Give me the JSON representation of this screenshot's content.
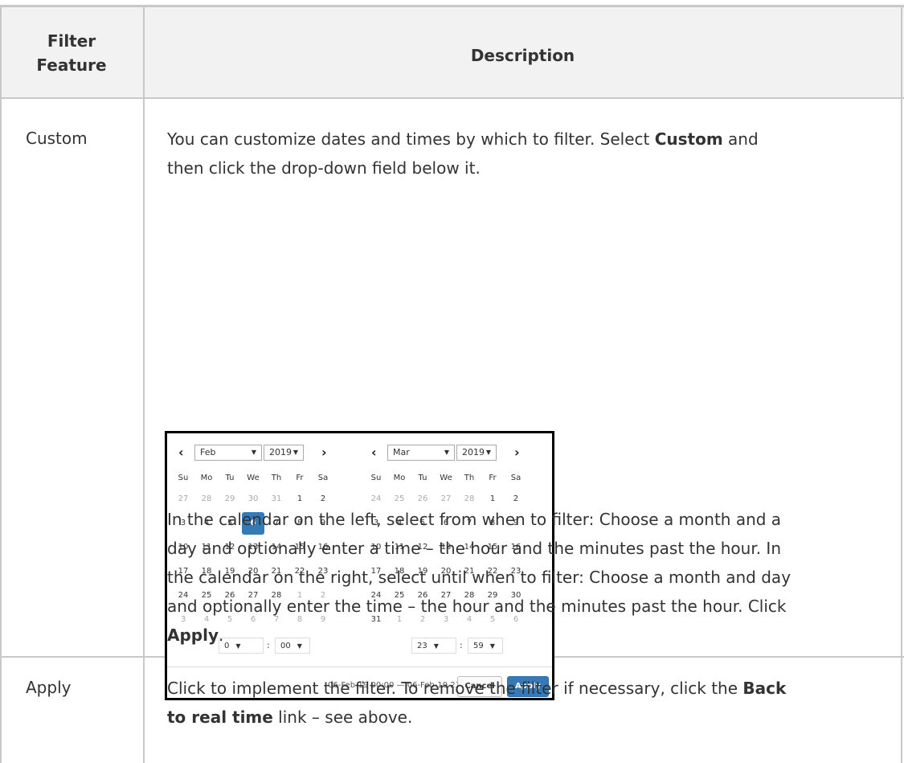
{
  "table": {
    "headers": [
      "Filter\nFeature",
      "Description"
    ],
    "header_col1_lines": [
      "Filter",
      "Feature"
    ],
    "header_col2": "Description"
  },
  "rows": [
    {
      "feature": "Custom",
      "intro_lines": [
        [
          "You can customize dates and times by which to filter. Select ",
          {
            "b": "Custom"
          },
          " and"
        ],
        [
          "then click the drop-down field below it."
        ]
      ],
      "after_lines": [
        [
          "In the calendar on the left, select from when to filter: Choose a month and a"
        ],
        [
          "day and optionally enter a time – the hour and the minutes past the hour. In"
        ],
        [
          "the calendar on the right, select until when to filter: Choose a month and day"
        ],
        [
          "and optionally enter the time – the hour and the minutes past the hour. Click"
        ],
        [
          {
            "b": "Apply"
          },
          "."
        ]
      ]
    },
    {
      "feature": "Apply",
      "lines": [
        [
          "Click to implement the filter. To remove the filter if necessary, click the ",
          {
            "b": "Back"
          }
        ],
        [
          {
            "b": "to real time"
          },
          " link – see above."
        ]
      ]
    }
  ],
  "calendar": {
    "weekdays": [
      "Su",
      "Mo",
      "Tu",
      "We",
      "Th",
      "Fr",
      "Sa"
    ],
    "left": {
      "month": "Feb",
      "year": "2019",
      "weeks": [
        [
          "27",
          "28",
          "29",
          "30",
          "31",
          "1",
          "2"
        ],
        [
          "3",
          "4",
          "5",
          "6",
          "7",
          "8",
          "9"
        ],
        [
          "10",
          "11",
          "12",
          "13",
          "14",
          "15",
          "16"
        ],
        [
          "17",
          "18",
          "19",
          "20",
          "21",
          "22",
          "23"
        ],
        [
          "24",
          "25",
          "26",
          "27",
          "28",
          "1",
          "2"
        ],
        [
          "3",
          "4",
          "5",
          "6",
          "7",
          "8",
          "9"
        ]
      ],
      "off": [
        [
          0,
          0
        ],
        [
          0,
          1
        ],
        [
          0,
          2
        ],
        [
          0,
          3
        ],
        [
          0,
          4
        ],
        [
          4,
          5
        ],
        [
          4,
          6
        ],
        [
          5,
          0
        ],
        [
          5,
          1
        ],
        [
          5,
          2
        ],
        [
          5,
          3
        ],
        [
          5,
          4
        ],
        [
          5,
          5
        ],
        [
          5,
          6
        ]
      ],
      "selected": [
        1,
        3
      ],
      "hour": "0",
      "minute": "00"
    },
    "right": {
      "month": "Mar",
      "year": "2019",
      "weeks": [
        [
          "24",
          "25",
          "26",
          "27",
          "28",
          "1",
          "2"
        ],
        [
          "3",
          "4",
          "5",
          "6",
          "7",
          "8",
          "9"
        ],
        [
          "10",
          "11",
          "12",
          "13",
          "14",
          "15",
          "16"
        ],
        [
          "17",
          "18",
          "19",
          "20",
          "21",
          "22",
          "23"
        ],
        [
          "24",
          "25",
          "26",
          "27",
          "28",
          "29",
          "30"
        ],
        [
          "31",
          "1",
          "2",
          "3",
          "4",
          "5",
          "6"
        ]
      ],
      "off": [
        [
          0,
          0
        ],
        [
          0,
          1
        ],
        [
          0,
          2
        ],
        [
          0,
          3
        ],
        [
          0,
          4
        ],
        [
          5,
          1
        ],
        [
          5,
          2
        ],
        [
          5,
          3
        ],
        [
          5,
          4
        ],
        [
          5,
          5
        ],
        [
          5,
          6
        ]
      ],
      "hour": "23",
      "minute": "59"
    },
    "prev_glyph": "‹",
    "next_glyph": "›",
    "range_text": "06-Feb-19 00:00 — 06-Feb-19 23:59",
    "cancel_label": "Cancel",
    "apply_label": "Apply",
    "accent": "#337ab7"
  }
}
